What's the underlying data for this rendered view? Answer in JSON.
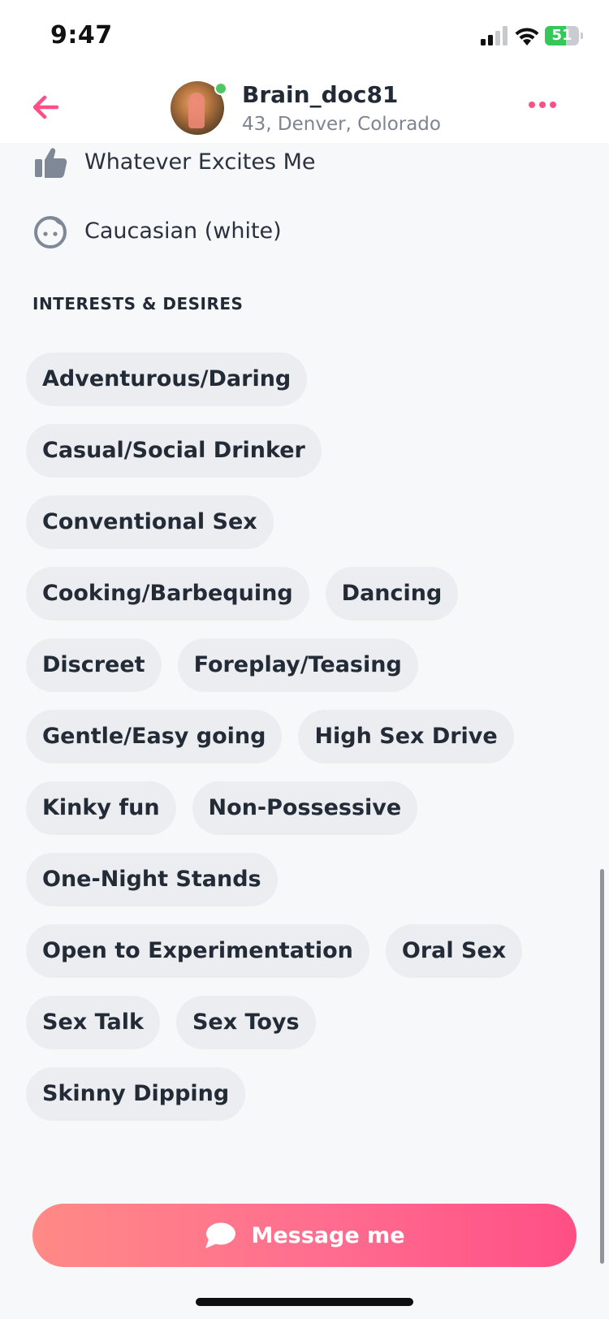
{
  "status_bar": {
    "time": "9:47",
    "battery": "51"
  },
  "header": {
    "username": "Brain_doc81",
    "subtitle": "43, Denver, Colorado"
  },
  "details": [
    {
      "icon": "thumbs-up-icon",
      "label": "Whatever Excites Me"
    },
    {
      "icon": "face-icon",
      "label": "Caucasian (white)"
    }
  ],
  "interests": {
    "title": "INTERESTS & DESIRES",
    "rows": [
      [
        "Adventurous/Daring"
      ],
      [
        "Casual/Social Drinker"
      ],
      [
        "Conventional Sex"
      ],
      [
        "Cooking/Barbequing",
        "Dancing"
      ],
      [
        "Discreet",
        "Foreplay/Teasing"
      ],
      [
        "Gentle/Easy going",
        "High Sex Drive"
      ],
      [
        "Kinky fun",
        "Non-Possessive"
      ],
      [
        "One-Night Stands"
      ],
      [
        "Open to Experimentation",
        "Oral Sex"
      ],
      [
        "Sex Talk",
        "Sex Toys"
      ],
      [
        "Skinny Dipping"
      ]
    ]
  },
  "message_button": {
    "label": "Message me"
  },
  "colors": {
    "accent": "#ff4f86",
    "chip_bg": "#ebedf0",
    "online": "#4cc764",
    "battery": "#34c759"
  }
}
